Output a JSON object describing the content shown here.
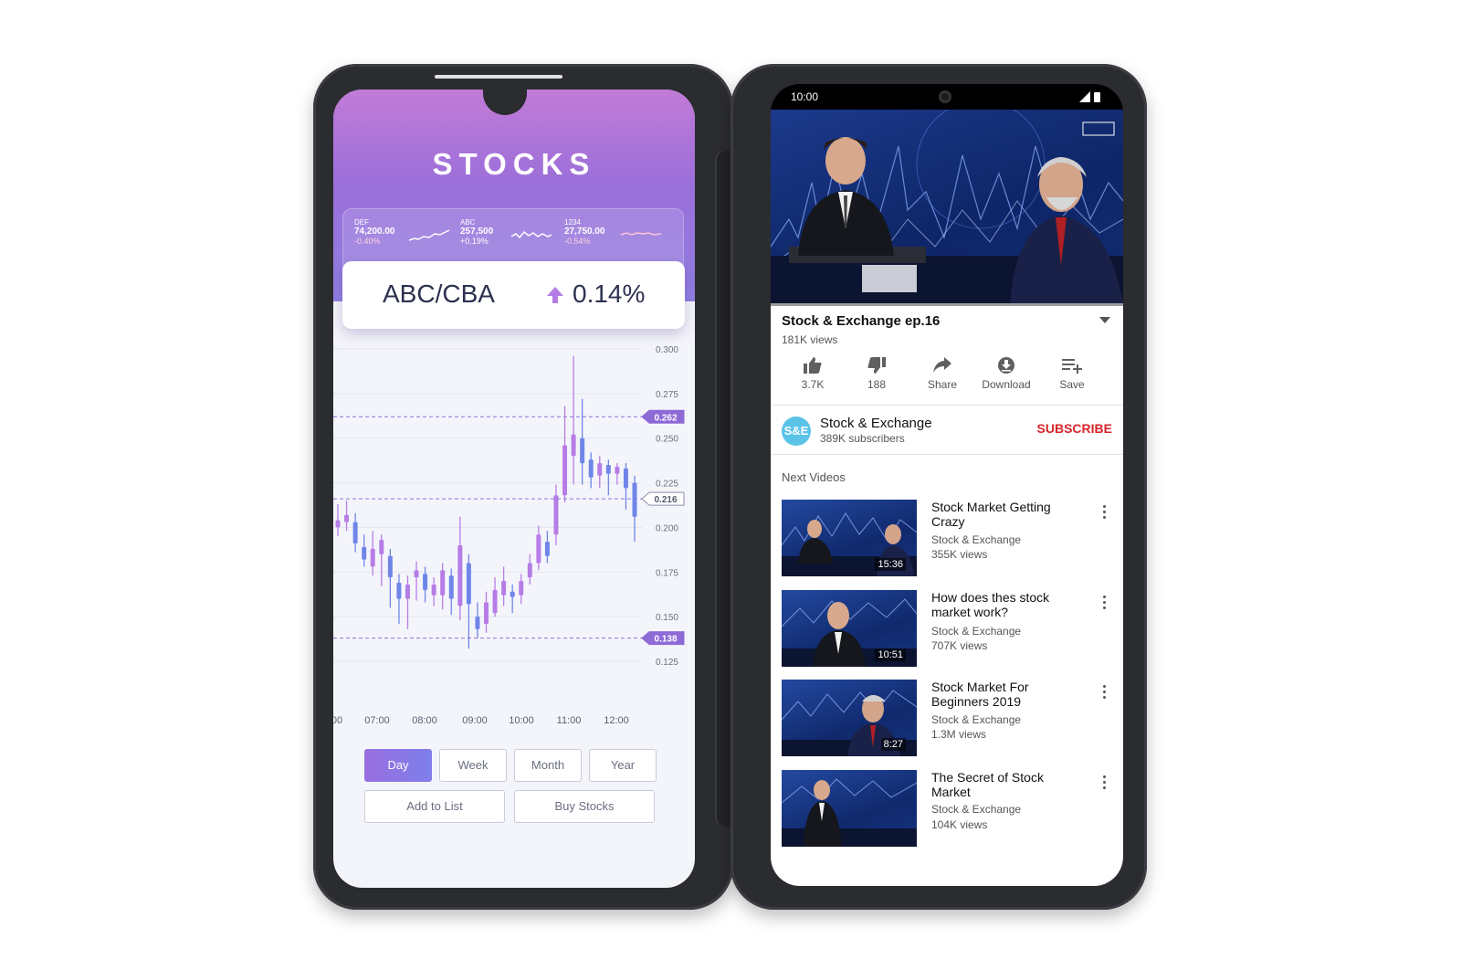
{
  "stocks_app": {
    "title": "STOCKS",
    "tickers": [
      {
        "name": "DEF",
        "price": "74,200.00",
        "change": "-0.40%"
      },
      {
        "name": "ABC",
        "price": "257,500",
        "change": "+0.19%"
      },
      {
        "name": "1234",
        "price": "27,750.00",
        "change": "-0.54%"
      }
    ],
    "pair": {
      "name": "ABC/CBA",
      "change": "0.14%",
      "direction": "up"
    },
    "range_buttons": [
      "Day",
      "Week",
      "Month",
      "Year"
    ],
    "selected_range": "Day",
    "actions": {
      "add_to_list": "Add to List",
      "buy_stocks": "Buy Stocks"
    },
    "colors": {
      "accent": "#9b6fd9",
      "candle_purple": "#b67de6",
      "candle_blue": "#6f86e8"
    }
  },
  "chart_data": {
    "type": "candlestick",
    "x_tick_labels": [
      "00",
      "07:00",
      "08:00",
      "09:00",
      "10:00",
      "11:00",
      "12:00"
    ],
    "y_tick_labels": [
      "0.300",
      "0.275",
      "0.250",
      "0.225",
      "0.200",
      "0.175",
      "0.150",
      "0.125"
    ],
    "ylim": [
      0.125,
      0.3
    ],
    "reference_levels": [
      {
        "value": 0.262,
        "label": "0.262",
        "style": "filled-purple"
      },
      {
        "value": 0.216,
        "label": "0.216",
        "style": "outline"
      },
      {
        "value": 0.138,
        "label": "0.138",
        "style": "filled-purple"
      }
    ],
    "candles": [
      {
        "o": 0.2,
        "c": 0.204,
        "h": 0.213,
        "l": 0.195
      },
      {
        "o": 0.203,
        "c": 0.207,
        "h": 0.215,
        "l": 0.198
      },
      {
        "o": 0.203,
        "c": 0.191,
        "h": 0.208,
        "l": 0.186
      },
      {
        "o": 0.189,
        "c": 0.182,
        "h": 0.196,
        "l": 0.178
      },
      {
        "o": 0.178,
        "c": 0.188,
        "h": 0.198,
        "l": 0.173
      },
      {
        "o": 0.185,
        "c": 0.193,
        "h": 0.196,
        "l": 0.167
      },
      {
        "o": 0.184,
        "c": 0.172,
        "h": 0.188,
        "l": 0.155
      },
      {
        "o": 0.169,
        "c": 0.16,
        "h": 0.174,
        "l": 0.146
      },
      {
        "o": 0.16,
        "c": 0.168,
        "h": 0.173,
        "l": 0.143
      },
      {
        "o": 0.172,
        "c": 0.176,
        "h": 0.181,
        "l": 0.159
      },
      {
        "o": 0.174,
        "c": 0.165,
        "h": 0.178,
        "l": 0.158
      },
      {
        "o": 0.162,
        "c": 0.168,
        "h": 0.172,
        "l": 0.156
      },
      {
        "o": 0.162,
        "c": 0.176,
        "h": 0.18,
        "l": 0.154
      },
      {
        "o": 0.173,
        "c": 0.16,
        "h": 0.177,
        "l": 0.151
      },
      {
        "o": 0.156,
        "c": 0.19,
        "h": 0.206,
        "l": 0.148
      },
      {
        "o": 0.18,
        "c": 0.157,
        "h": 0.185,
        "l": 0.132
      },
      {
        "o": 0.15,
        "c": 0.143,
        "h": 0.158,
        "l": 0.138
      },
      {
        "o": 0.146,
        "c": 0.158,
        "h": 0.164,
        "l": 0.141
      },
      {
        "o": 0.152,
        "c": 0.165,
        "h": 0.172,
        "l": 0.15
      },
      {
        "o": 0.162,
        "c": 0.17,
        "h": 0.178,
        "l": 0.156
      },
      {
        "o": 0.164,
        "c": 0.161,
        "h": 0.168,
        "l": 0.152
      },
      {
        "o": 0.162,
        "c": 0.17,
        "h": 0.174,
        "l": 0.157
      },
      {
        "o": 0.172,
        "c": 0.18,
        "h": 0.185,
        "l": 0.168
      },
      {
        "o": 0.18,
        "c": 0.196,
        "h": 0.201,
        "l": 0.176
      },
      {
        "o": 0.192,
        "c": 0.184,
        "h": 0.198,
        "l": 0.18
      },
      {
        "o": 0.196,
        "c": 0.218,
        "h": 0.224,
        "l": 0.19
      },
      {
        "o": 0.218,
        "c": 0.246,
        "h": 0.268,
        "l": 0.214
      },
      {
        "o": 0.24,
        "c": 0.252,
        "h": 0.296,
        "l": 0.224
      },
      {
        "o": 0.25,
        "c": 0.236,
        "h": 0.272,
        "l": 0.224
      },
      {
        "o": 0.238,
        "c": 0.228,
        "h": 0.242,
        "l": 0.222
      },
      {
        "o": 0.229,
        "c": 0.236,
        "h": 0.24,
        "l": 0.222
      },
      {
        "o": 0.235,
        "c": 0.23,
        "h": 0.238,
        "l": 0.218
      },
      {
        "o": 0.23,
        "c": 0.234,
        "h": 0.236,
        "l": 0.224
      },
      {
        "o": 0.233,
        "c": 0.222,
        "h": 0.236,
        "l": 0.21
      },
      {
        "o": 0.225,
        "c": 0.206,
        "h": 0.229,
        "l": 0.192
      }
    ]
  },
  "video_app": {
    "status_time": "10:00",
    "video": {
      "title": "Stock & Exchange ep.16",
      "views": "181K views",
      "progress": 0
    },
    "actions": [
      {
        "icon": "thumbs-up-icon",
        "label": "3.7K"
      },
      {
        "icon": "thumbs-down-icon",
        "label": "188"
      },
      {
        "icon": "share-icon",
        "label": "Share"
      },
      {
        "icon": "download-icon",
        "label": "Download"
      },
      {
        "icon": "save-icon",
        "label": "Save"
      }
    ],
    "channel": {
      "avatar_text": "S&E",
      "name": "Stock & Exchange",
      "subscribers": "389K subscribers",
      "subscribe_label": "SUBSCRIBE"
    },
    "next_label": "Next Videos",
    "next_videos": [
      {
        "title": "Stock Market Getting Crazy",
        "channel": "Stock & Exchange",
        "views": "355K views",
        "duration": "15:36"
      },
      {
        "title": "How does thes stock market work?",
        "channel": "Stock & Exchange",
        "views": "707K views",
        "duration": "10:51"
      },
      {
        "title": "Stock Market For Beginners 2019",
        "channel": "Stock & Exchange",
        "views": "1.3M views",
        "duration": "8:27"
      },
      {
        "title": "The Secret of Stock Market",
        "channel": "Stock & Exchange",
        "views": "104K views",
        "duration": ""
      }
    ]
  }
}
